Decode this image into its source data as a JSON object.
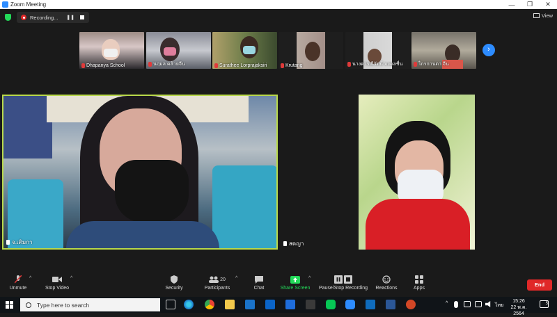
{
  "window": {
    "title": "Zoom Meeting",
    "minimize": "—",
    "restore": "❐",
    "close": "✕"
  },
  "topbar": {
    "recording_label": "Recording...",
    "pause_glyph": "❚❚",
    "view_label": "View"
  },
  "thumbnails": [
    {
      "name": "Dhapanya School",
      "muted": true
    },
    {
      "name": "นฤมล คล้ายจีน",
      "muted": true
    },
    {
      "name": "Surathee  Lorprajaksiri",
      "muted": true
    },
    {
      "name": "Krutang",
      "muted": true
    },
    {
      "name": "นางดารณีรัตน์ มงคลชื่น",
      "muted": true
    },
    {
      "name": "ไกรกานตา จีน",
      "muted": true
    }
  ],
  "next_glyph": "›",
  "main": [
    {
      "name": "จ.เติมกา"
    },
    {
      "name": "สดญา"
    }
  ],
  "toolbar": {
    "unmute": "Unmute",
    "stop_video": "Stop Video",
    "security": "Security",
    "participants": "Participants",
    "participants_count": "20",
    "chat": "Chat",
    "share_screen": "Share Screen",
    "pause_stop_recording": "Pause/Stop Recording",
    "reactions": "Reactions",
    "apps": "Apps",
    "end": "End",
    "caret": "^"
  },
  "taskbar": {
    "search_placeholder": "Type here to search",
    "language": "ไทย",
    "time": "15:26",
    "date": "22 พ.ค. 2564",
    "notification_count": "5"
  },
  "colors": {
    "accent": "#2d8cff",
    "recording": "#e02828",
    "share": "#23d959",
    "active_speaker": "#b9d94a"
  }
}
